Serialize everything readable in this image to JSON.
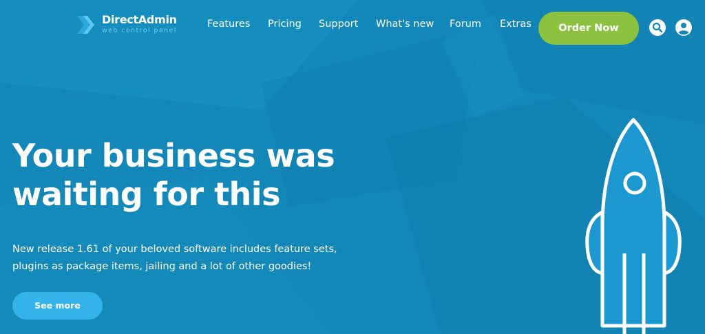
{
  "header": {
    "logo": {
      "name": "DirectAdmin",
      "tagline": "web control panel",
      "icon": "double-chevron-logo-icon"
    },
    "nav": [
      {
        "label": "Features"
      },
      {
        "label": "Pricing"
      },
      {
        "label": "Support"
      },
      {
        "label": "What's new"
      },
      {
        "label": "Forum"
      },
      {
        "label": "Extras"
      }
    ],
    "order_button": "Order Now",
    "search_icon": "search-icon",
    "account_icon": "user-account-icon"
  },
  "hero": {
    "title_lines": [
      "Your business was",
      "waiting for this"
    ],
    "description_lines": [
      "New release 1.61 of your beloved software includes feature sets,",
      "plugins as package items, jailing and a lot of other goodies!"
    ],
    "cta": "See more",
    "illustration_icon": "rocket-icon"
  },
  "colors": {
    "background": "#1387b8",
    "order_button": "#8cc03f",
    "cta_button": "#33b4ea",
    "logo_accent": "#6ed0ef",
    "text": "#ffffff"
  }
}
